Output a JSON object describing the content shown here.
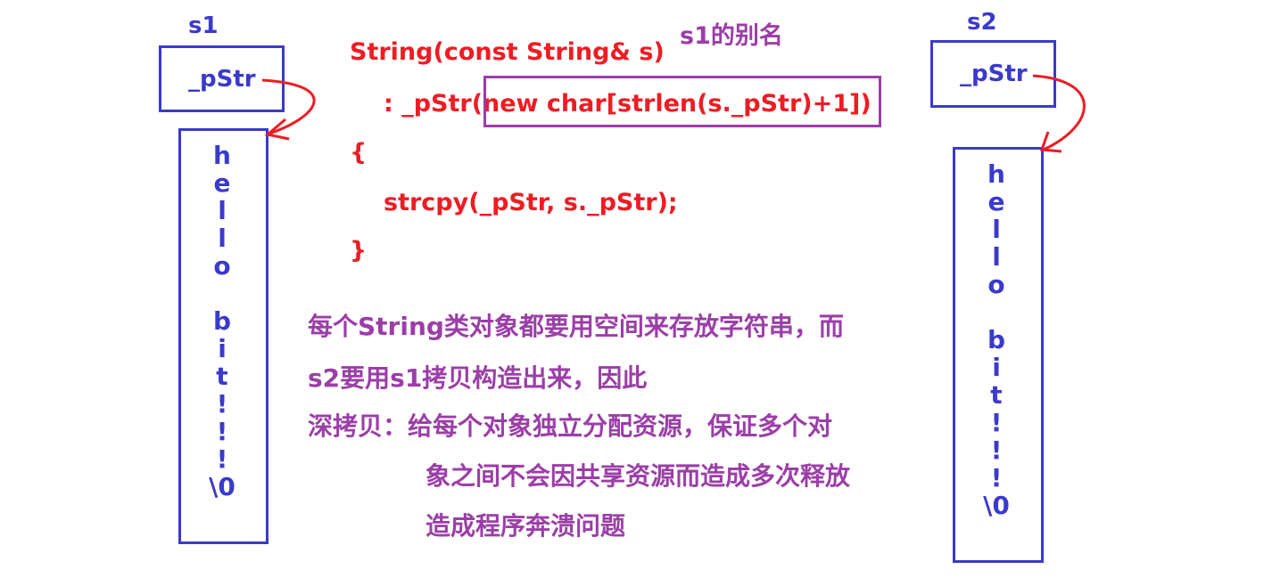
{
  "left_object": {
    "label": "s1",
    "pointer_field": "_pStr",
    "chars": [
      "h",
      "e",
      "l",
      "l",
      "o",
      "",
      "b",
      "i",
      "t",
      "!",
      "!",
      "!",
      "\\0"
    ]
  },
  "right_object": {
    "label": "s2",
    "pointer_field": "_pStr",
    "chars": [
      "h",
      "e",
      "l",
      "l",
      "o",
      "",
      "b",
      "i",
      "t",
      "!",
      "!",
      "!",
      "\\0"
    ]
  },
  "annotation": "s1的别名",
  "code": {
    "line1": "String(const String& s)",
    "line2_prefix": ": _pStr(",
    "line2_highlight": "new char[strlen(s._pStr)+1]",
    "line2_suffix": ")",
    "line3": "{",
    "line4": "strcpy(_pStr, s._pStr);",
    "line5": "}"
  },
  "explanation": {
    "line1": "每个String类对象都要用空间来存放字符串，而",
    "line2": "s2要用s1拷贝构造出来，因此",
    "line3": "深拷贝：给每个对象独立分配资源，保证多个对",
    "line4": "象之间不会因共享资源而造成多次释放",
    "line5": "造成程序奔溃问题"
  },
  "colors": {
    "box_border": "#3a3acc",
    "code_text": "#ee1c24",
    "arrow": "#ee1c24",
    "explanation_text": "#9b3ea7",
    "highlight_border": "#9b3ea7"
  }
}
